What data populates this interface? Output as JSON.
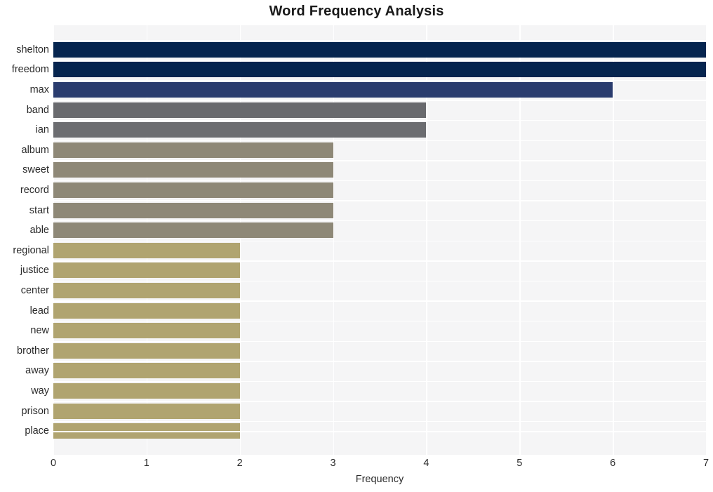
{
  "chart_data": {
    "type": "bar",
    "orientation": "horizontal",
    "title": "Word Frequency Analysis",
    "xlabel": "Frequency",
    "ylabel": "",
    "xlim": [
      0,
      7
    ],
    "xticks": [
      "0",
      "1",
      "2",
      "3",
      "4",
      "5",
      "6",
      "7"
    ],
    "grid": true,
    "legend": "none",
    "categories": [
      "shelton",
      "freedom",
      "max",
      "band",
      "ian",
      "album",
      "sweet",
      "record",
      "start",
      "able",
      "regional",
      "justice",
      "center",
      "lead",
      "new",
      "brother",
      "away",
      "way",
      "prison",
      "place"
    ],
    "values": [
      7,
      7,
      6,
      4,
      4,
      3,
      3,
      3,
      3,
      3,
      2,
      2,
      2,
      2,
      2,
      2,
      2,
      2,
      2,
      2
    ],
    "bar_colors": [
      "#06254f",
      "#06254f",
      "#2a3c6e",
      "#696a6e",
      "#6c6d71",
      "#8e8877",
      "#8e8877",
      "#8e8877",
      "#8e8877",
      "#8e8877",
      "#b0a470",
      "#b0a470",
      "#b0a470",
      "#b0a470",
      "#b0a470",
      "#b0a470",
      "#b0a470",
      "#b0a470",
      "#b0a470",
      "#b0a470"
    ],
    "plot_background": "#f5f5f6",
    "gridline_color": "#ffffff",
    "text_color": "#2b2b2b"
  }
}
